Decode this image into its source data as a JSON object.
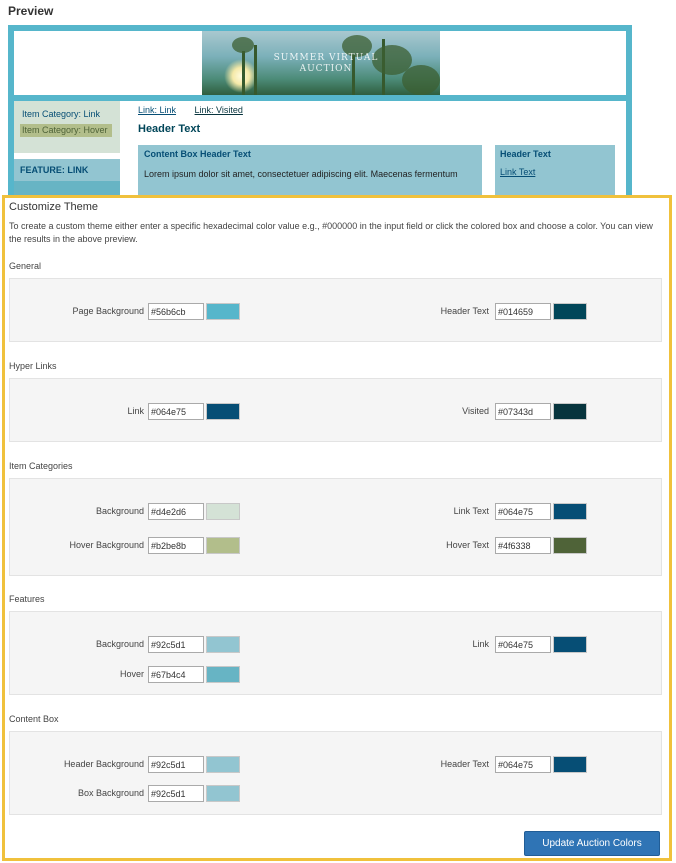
{
  "preview": {
    "title": "Preview",
    "banner_text_line1": "SUMMER VIRTUAL",
    "banner_text_line2": "AUCTION",
    "item_category_link": "Item Category: Link",
    "item_category_hover": "Item Category: Hover",
    "feature_link": "FEATURE: LINK",
    "link": "Link: Link",
    "visited": "Link: Visited",
    "header_text": "Header Text",
    "content_box_header": "Content Box Header Text",
    "content_box_text": "Lorem ipsum dolor sit amet, consectetuer adipiscing elit. Maecenas fermentum",
    "side_header": "Header Text",
    "side_link": "Link Text"
  },
  "customize": {
    "title": "Customize Theme",
    "description": "To create a custom theme either enter a specific hexadecimal color value e.g., #000000 in the input field or click the colored box and choose a color. You can view the results in the above preview.",
    "sections": {
      "general": {
        "title": "General",
        "page_background": {
          "label": "Page Background",
          "value": "#56b6cb",
          "color": "#56b6cb"
        },
        "header_text": {
          "label": "Header Text",
          "value": "#014659",
          "color": "#014659"
        }
      },
      "hyper_links": {
        "title": "Hyper Links",
        "link": {
          "label": "Link",
          "value": "#064e75",
          "color": "#064e75"
        },
        "visited": {
          "label": "Visited",
          "value": "#07343d",
          "color": "#07343d"
        }
      },
      "item_categories": {
        "title": "Item Categories",
        "background": {
          "label": "Background",
          "value": "#d4e2d6",
          "color": "#d4e2d6"
        },
        "link_text": {
          "label": "Link Text",
          "value": "#064e75",
          "color": "#064e75"
        },
        "hover_background": {
          "label": "Hover Background",
          "value": "#b2be8b",
          "color": "#b2be8b"
        },
        "hover_text": {
          "label": "Hover Text",
          "value": "#4f6338",
          "color": "#4f6338"
        }
      },
      "features": {
        "title": "Features",
        "background": {
          "label": "Background",
          "value": "#92c5d1",
          "color": "#92c5d1"
        },
        "link": {
          "label": "Link",
          "value": "#064e75",
          "color": "#064e75"
        },
        "hover": {
          "label": "Hover",
          "value": "#67b4c4",
          "color": "#67b4c4"
        }
      },
      "content_box": {
        "title": "Content Box",
        "header_background": {
          "label": "Header Background",
          "value": "#92c5d1",
          "color": "#92c5d1"
        },
        "header_text": {
          "label": "Header Text",
          "value": "#064e75",
          "color": "#064e75"
        },
        "box_background": {
          "label": "Box Background",
          "value": "#92c5d1",
          "color": "#92c5d1"
        }
      }
    },
    "update_button": "Update Auction Colors"
  }
}
